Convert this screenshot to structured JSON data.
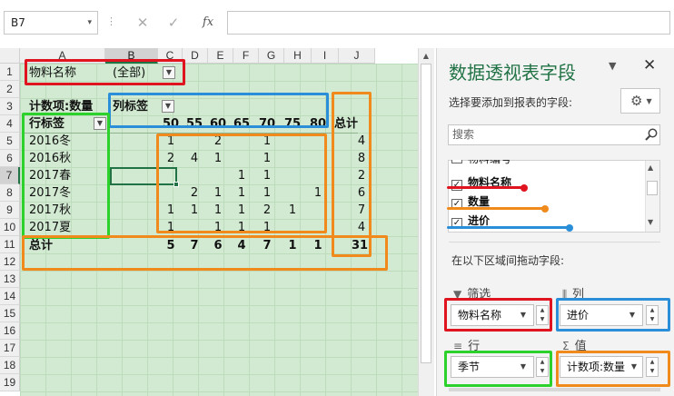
{
  "formula_bar": {
    "name_box": "B7",
    "dropdown_glyph": "▾",
    "dots": "⋮",
    "cancel": "✕",
    "enter": "✓",
    "fx": "fx",
    "formula": ""
  },
  "sheet": {
    "columns": [
      "A",
      "B",
      "C",
      "D",
      "E",
      "F",
      "G",
      "H",
      "I",
      "J"
    ],
    "rows": [
      "1",
      "2",
      "3",
      "4",
      "5",
      "6",
      "7",
      "8",
      "9",
      "10",
      "11",
      "12",
      "13",
      "14",
      "15",
      "16",
      "17",
      "18",
      "19"
    ],
    "filter_label": "物料名称",
    "filter_value": "(全部)",
    "value_label": "计数项:数量",
    "col_labels_label": "列标签",
    "row_labels_label": "行标签",
    "grand_total_col": "总计",
    "grand_total_row": "总计",
    "col_keys": [
      "50",
      "55",
      "60",
      "65",
      "70",
      "75",
      "80"
    ],
    "row_items": [
      {
        "label": "2016冬",
        "values": [
          "1",
          "",
          "2",
          "",
          "1",
          "",
          ""
        ],
        "total": "4"
      },
      {
        "label": "2016秋",
        "values": [
          "2",
          "4",
          "1",
          "",
          "1",
          "",
          ""
        ],
        "total": "8"
      },
      {
        "label": "2017春",
        "values": [
          "",
          "",
          "",
          "1",
          "1",
          "",
          ""
        ],
        "total": "2"
      },
      {
        "label": "2017冬",
        "values": [
          "",
          "2",
          "1",
          "1",
          "1",
          "",
          "1"
        ],
        "total": "6"
      },
      {
        "label": "2017秋",
        "values": [
          "1",
          "1",
          "1",
          "1",
          "2",
          "1",
          ""
        ],
        "total": "7"
      },
      {
        "label": "2017夏",
        "values": [
          "1",
          "",
          "1",
          "1",
          "1",
          "",
          ""
        ],
        "total": "4"
      }
    ],
    "col_totals": [
      "5",
      "7",
      "6",
      "4",
      "7",
      "1",
      "1"
    ],
    "grand_total": "31"
  },
  "pane": {
    "title": "数据透视表字段",
    "menu_glyph": "▼",
    "close_glyph": "✕",
    "subtitle": "选择要添加到报表的字段:",
    "gear_glyph": "⚙",
    "gear_dd": "▼",
    "search_placeholder": "搜索",
    "fields": [
      {
        "label": "物料编号",
        "checked": false
      },
      {
        "label": "物料名称",
        "checked": true
      },
      {
        "label": "数量",
        "checked": true
      },
      {
        "label": "进价",
        "checked": true
      }
    ],
    "drag_label": "在以下区域间拖动字段:",
    "filters_header": "筛选",
    "columns_header": "列",
    "rows_header": "行",
    "values_header": "值",
    "filter_chip": "物料名称",
    "column_chip": "进价",
    "row_chip": "季节",
    "value_chip": "计数项:数量",
    "chip_dd": "▼",
    "spin_up": "▲",
    "spin_down": "▼",
    "check_glyph": "✓"
  },
  "colors": {
    "accent": "#217346",
    "sheet_fill": "#d2ead2",
    "annotation_red": "#e0141e",
    "annotation_blue": "#2a8fd8",
    "annotation_green": "#2cd12c",
    "annotation_orange": "#f08a1c"
  }
}
